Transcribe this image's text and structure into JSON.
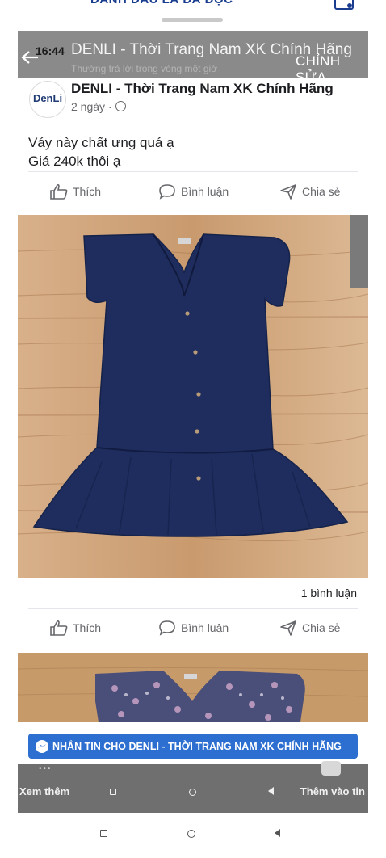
{
  "outer_header": {
    "label": "ĐÁNH DẤU LÀ ĐÃ ĐỌC"
  },
  "page_header": {
    "time": "16:44",
    "title": "DENLI - Thời Trang Nam XK Chính Hãng",
    "subtitle": "Thường trả lời trong vòng một giờ",
    "edit_label": "CHỈNH SỬA"
  },
  "post": {
    "avatar_text": "DenLi",
    "page_name": "DENLI - Thời Trang Nam XK Chính Hãng",
    "time_ago": "2 ngày ·",
    "text_line1": "Váy này chất ưng quá ạ",
    "text_line2": "Giá 240k thôi ạ",
    "comments_count": "1 bình luận"
  },
  "actions": {
    "like": "Thích",
    "comment": "Bình luận",
    "share": "Chia sẻ"
  },
  "messenger_button": {
    "label": "NHẮN TIN CHO DENLI - THỜI TRANG NAM XK CHÍNH HÃNG"
  },
  "overlay_nav": {
    "see_more": "Xem thêm",
    "add_story": "Thêm vào tin"
  },
  "colors": {
    "accent": "#2d6fd1",
    "dress_navy": "#1e2d5e",
    "wood": "#c79a6a"
  },
  "icons": [
    "back-arrow-icon",
    "globe-icon",
    "like-icon",
    "comment-icon",
    "share-icon",
    "messenger-icon",
    "recents-icon",
    "home-icon",
    "back-icon"
  ]
}
